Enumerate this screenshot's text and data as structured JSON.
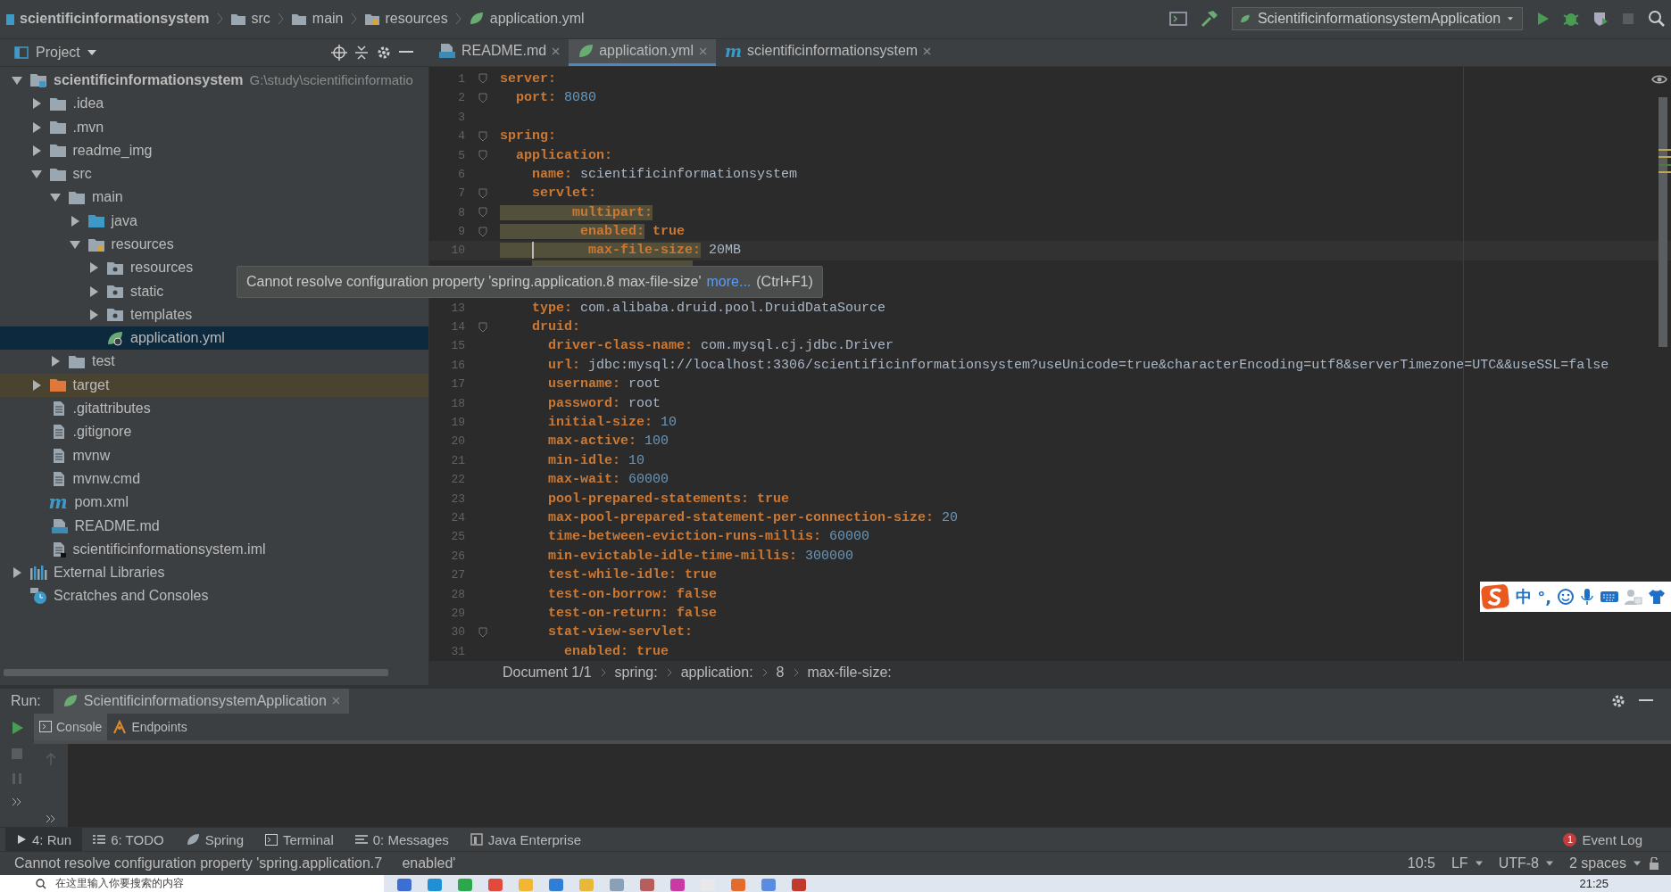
{
  "nav": {
    "breadcrumbs": [
      {
        "label": "scientificinformationsystem",
        "kind": "module"
      },
      {
        "label": "src",
        "kind": "folder"
      },
      {
        "label": "main",
        "kind": "folder"
      },
      {
        "label": "resources",
        "kind": "resources"
      },
      {
        "label": "application.yml",
        "kind": "spring"
      }
    ],
    "run_config": "ScientificinformationsystemApplication"
  },
  "project": {
    "title": "Project",
    "tree": [
      {
        "label": "scientificinformationsystem",
        "path": "G:\\study\\scientificinformatio",
        "kind": "module",
        "expanded": true,
        "selected": false,
        "children": [
          {
            "label": ".idea",
            "kind": "folder",
            "expanded": false,
            "selected": false
          },
          {
            "label": ".mvn",
            "kind": "folder",
            "expanded": false,
            "selected": false
          },
          {
            "label": "readme_img",
            "kind": "folder",
            "expanded": false,
            "selected": false
          },
          {
            "label": "src",
            "kind": "folder",
            "expanded": true,
            "selected": false,
            "children": [
              {
                "label": "main",
                "kind": "folder",
                "expanded": true,
                "selected": false,
                "children": [
                  {
                    "label": "java",
                    "kind": "source",
                    "expanded": false,
                    "selected": false
                  },
                  {
                    "label": "resources",
                    "kind": "resources",
                    "expanded": true,
                    "selected": false,
                    "children": [
                      {
                        "label": "resources",
                        "kind": "web",
                        "expanded": false,
                        "selected": false
                      },
                      {
                        "label": "static",
                        "kind": "web",
                        "expanded": false,
                        "selected": false
                      },
                      {
                        "label": "templates",
                        "kind": "web",
                        "expanded": false,
                        "selected": false
                      },
                      {
                        "label": "application.yml",
                        "kind": "spring",
                        "selected": true
                      }
                    ]
                  }
                ]
              },
              {
                "label": "test",
                "kind": "folder",
                "expanded": false,
                "selected": false
              }
            ]
          },
          {
            "label": "target",
            "kind": "excluded",
            "expanded": false,
            "selected": false
          },
          {
            "label": ".gitattributes",
            "kind": "file",
            "selected": false
          },
          {
            "label": ".gitignore",
            "kind": "file",
            "selected": false
          },
          {
            "label": "mvnw",
            "kind": "file",
            "selected": false
          },
          {
            "label": "mvnw.cmd",
            "kind": "file",
            "selected": false
          },
          {
            "label": "pom.xml",
            "kind": "maven",
            "glyph": "m",
            "selected": false
          },
          {
            "label": "README.md",
            "kind": "md",
            "selected": false
          },
          {
            "label": "scientificinformationsystem.iml",
            "kind": "iml",
            "selected": false
          }
        ]
      },
      {
        "label": "External Libraries",
        "kind": "libraries",
        "expanded": false,
        "selected": false
      },
      {
        "label": "Scratches and Consoles",
        "kind": "scratches",
        "selected": false
      }
    ]
  },
  "editor": {
    "tabs": [
      {
        "label": "README.md",
        "kind": "md",
        "selected": false
      },
      {
        "label": "application.yml",
        "kind": "spring",
        "selected": true
      },
      {
        "label": "scientificinformationsystem",
        "kind": "maven",
        "glyph": "m",
        "selected": false
      }
    ],
    "lines": [
      {
        "num": "1",
        "key": "server:",
        "fold": true
      },
      {
        "num": "2",
        "key": "  port:",
        "value": "8080",
        "kind": "number",
        "fold": true
      },
      {
        "num": "3"
      },
      {
        "num": "4",
        "key": "spring:",
        "fold": true
      },
      {
        "num": "5",
        "key": "  application:",
        "fold": true
      },
      {
        "num": "6",
        "key": "    name:",
        "value": "scientificinformationsystem",
        "kind": "string"
      },
      {
        "num": "7",
        "key": "    servlet:",
        "fold": true
      },
      {
        "num": "8",
        "key": "         multipart:",
        "fold": true,
        "warning": true
      },
      {
        "num": "9",
        "key": "          enabled:",
        "value": "true",
        "kind": "bool",
        "fold": true,
        "warning": true
      },
      {
        "num": "10",
        "key": "           max-file-size:",
        "value": "20MB",
        "kind": "string",
        "warning": true,
        "current": true
      },
      {
        "warning": true
      },
      {
        "num": "13",
        "key": "    type:",
        "value": "com.alibaba.druid.pool.DruidDataSource",
        "kind": "string"
      },
      {
        "num": "14",
        "key": "    druid:",
        "fold": true
      },
      {
        "num": "15",
        "key": "      driver-class-name:",
        "value": "com.mysql.cj.jdbc.Driver",
        "kind": "string"
      },
      {
        "num": "16",
        "key": "      url:",
        "value": "jdbc:mysql://localhost:3306/scientificinformationsystem?useUnicode=true&characterEncoding=utf8&serverTimezone=UTC&&useSSL=false",
        "kind": "string"
      },
      {
        "num": "17",
        "key": "      username:",
        "value": "root",
        "kind": "string"
      },
      {
        "num": "18",
        "key": "      password:",
        "value": "root",
        "kind": "string"
      },
      {
        "num": "19",
        "key": "      initial-size:",
        "value": "10",
        "kind": "number"
      },
      {
        "num": "20",
        "key": "      max-active:",
        "value": "100",
        "kind": "number"
      },
      {
        "num": "21",
        "key": "      min-idle:",
        "value": "10",
        "kind": "number"
      },
      {
        "num": "22",
        "key": "      max-wait:",
        "value": "60000",
        "kind": "number"
      },
      {
        "num": "23",
        "key": "      pool-prepared-statements:",
        "value": "true",
        "kind": "bool"
      },
      {
        "num": "24",
        "key": "      max-pool-prepared-statement-per-connection-size:",
        "value": "20",
        "kind": "number"
      },
      {
        "num": "25",
        "key": "      time-between-eviction-runs-millis:",
        "value": "60000",
        "kind": "number"
      },
      {
        "num": "26",
        "key": "      min-evictable-idle-time-millis:",
        "value": "300000",
        "kind": "number"
      },
      {
        "num": "27",
        "key": "      test-while-idle:",
        "value": "true",
        "kind": "bool"
      },
      {
        "num": "28",
        "key": "      test-on-borrow:",
        "value": "false",
        "kind": "bool"
      },
      {
        "num": "29",
        "key": "      test-on-return:",
        "value": "false",
        "kind": "bool"
      },
      {
        "num": "30",
        "key": "      stat-view-servlet:",
        "fold": true
      },
      {
        "num": "31",
        "key": "        enabled:",
        "value": "true",
        "kind": "bool"
      }
    ],
    "tooltip": {
      "message": "Cannot resolve configuration property 'spring.application.8 max-file-size'",
      "link": "more...",
      "shortcut": "(Ctrl+F1)"
    },
    "breadcrumbs": [
      "Document 1/1",
      "spring:",
      "application:",
      "8",
      "max-file-size:"
    ]
  },
  "ime": {
    "items": [
      "中",
      "°,"
    ]
  },
  "run": {
    "label": "Run:",
    "config": "ScientificinformationsystemApplication",
    "tabs": [
      {
        "label": "Console",
        "kind": "console",
        "selected": true
      },
      {
        "label": "Endpoints",
        "kind": "endpoints",
        "selected": false
      }
    ]
  },
  "tool_windows": [
    {
      "label": "4: Run",
      "kind": "run",
      "selected": true
    },
    {
      "label": "6: TODO",
      "kind": "todo",
      "selected": false
    },
    {
      "label": "Spring",
      "kind": "spring",
      "selected": false
    },
    {
      "label": "Terminal",
      "kind": "terminal",
      "selected": false
    },
    {
      "label": "0: Messages",
      "kind": "messages",
      "selected": false
    },
    {
      "label": "Java Enterprise",
      "kind": "enterprise",
      "selected": false
    }
  ],
  "event_log": {
    "label": "Event Log",
    "count": "1"
  },
  "status_bar": {
    "message": "Cannot resolve configuration property 'spring.application.7     enabled'",
    "position": "10:5",
    "line_sep": "LF",
    "encoding": "UTF-8",
    "indent": "2 spaces"
  },
  "taskbar": {
    "search_placeholder": "在这里输入你要搜索的内容",
    "clock": "21:25"
  }
}
